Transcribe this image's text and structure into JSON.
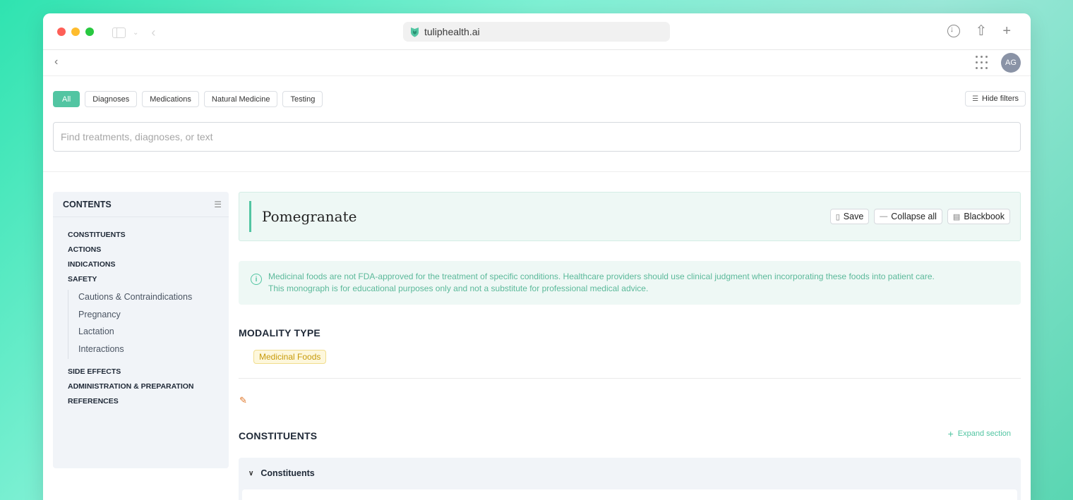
{
  "browser": {
    "url": "tuliphealth.ai"
  },
  "header": {
    "avatar_initials": "AG"
  },
  "filters": {
    "chips": [
      "All",
      "Diagnoses",
      "Medications",
      "Natural Medicine",
      "Testing"
    ],
    "hide_label": "Hide filters"
  },
  "search": {
    "placeholder": "Find treatments, diagnoses, or text"
  },
  "contents": {
    "title": "CONTENTS",
    "items_top": [
      "CONSTITUENTS",
      "ACTIONS",
      "INDICATIONS",
      "SAFETY"
    ],
    "safety_sub": [
      "Cautions & Contraindications",
      "Pregnancy",
      "Lactation",
      "Interactions"
    ],
    "items_bottom": [
      "SIDE EFFECTS",
      "ADMINISTRATION & PREPARATION",
      "REFERENCES"
    ]
  },
  "monograph": {
    "title": "Pomegranate",
    "save_label": "Save",
    "collapse_label": "Collapse all",
    "blackbook_label": "Blackbook",
    "notice_line1": "Medicinal foods are not FDA-approved for the treatment of specific conditions. Healthcare providers should use clinical judgment when incorporating these foods into patient care.",
    "notice_line2": "This monograph is for educational purposes only and not a substitute for professional medical advice.",
    "modality_heading": "MODALITY TYPE",
    "modality_badge": "Medicinal Foods",
    "constituents_heading": "CONSTITUENTS",
    "expand_label": "Expand section",
    "accordion_label": "Constituents"
  },
  "colors": {
    "accent": "#52c5a2",
    "badge_text": "#c79a0a"
  }
}
